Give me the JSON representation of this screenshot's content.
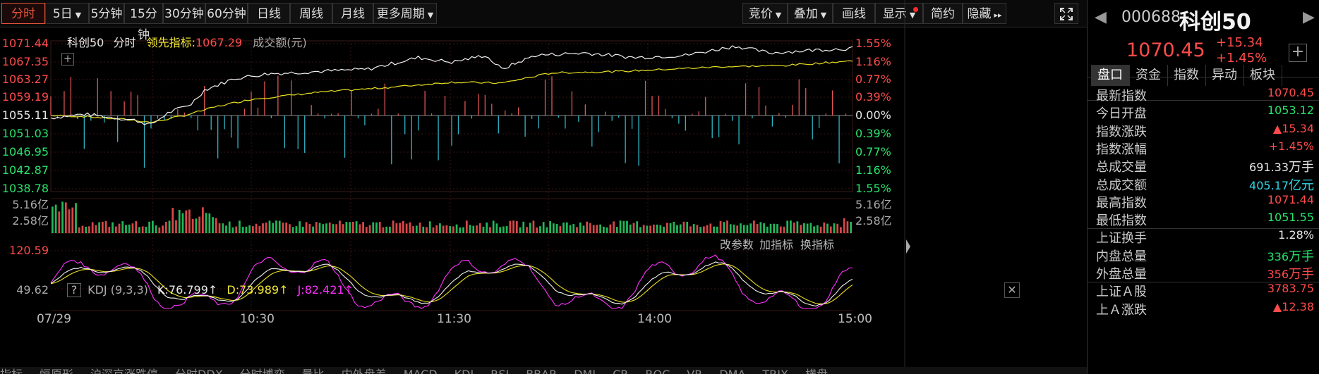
{
  "toolbar": {
    "left_buttons": [
      {
        "label": "分时",
        "active": true
      },
      {
        "label": "5日",
        "dropdown": true
      },
      {
        "label": "5分钟"
      },
      {
        "label": "15分钟"
      },
      {
        "label": "30分钟"
      },
      {
        "label": "60分钟"
      },
      {
        "label": "日线"
      },
      {
        "label": "周线"
      },
      {
        "label": "月线"
      },
      {
        "label": "更多周期",
        "dropdown": true
      }
    ],
    "right_buttons": [
      {
        "label": "竞价",
        "dropdown": true
      },
      {
        "label": "叠加",
        "dropdown": true
      },
      {
        "label": "画线"
      },
      {
        "label": "显示",
        "dropdown": true,
        "dot": true
      },
      {
        "label": "简约"
      },
      {
        "label": "隐藏",
        "arrows": "▸▸"
      }
    ]
  },
  "legend": {
    "name": "科创50",
    "mode": "分时",
    "lead_label": "领先指标:",
    "lead_value": "1067.29",
    "volume_label": "成交额(元)"
  },
  "price_axis": {
    "left": [
      "1071.44",
      "1067.35",
      "1063.27",
      "1059.19",
      "1055.11",
      "1051.03",
      "1046.95",
      "1042.87",
      "1038.78"
    ],
    "right": [
      "1.55%",
      "1.16%",
      "0.77%",
      "0.39%",
      "0.00%",
      "0.39%",
      "0.77%",
      "1.16%",
      "1.55%"
    ]
  },
  "volume_axis": {
    "top": "5.16亿",
    "mid": "2.58亿"
  },
  "kdj": {
    "label": "KDJ (9,3,3)",
    "k": "K:76.799↑",
    "d": "D:73.989↑",
    "j": "J:82.421↑",
    "axis_top": "120.59",
    "axis_mid": "49.62",
    "tools": [
      "改参数",
      "加指标",
      "换指标"
    ]
  },
  "time_axis": [
    "07/29",
    "10:30",
    "11:30",
    "14:00",
    "15:00"
  ],
  "chart_data": {
    "type": "line",
    "price_range": [
      1038.78,
      1071.44
    ],
    "prev_close": 1055.11,
    "x_range": [
      "09:30",
      "15:00"
    ],
    "series": [
      {
        "name": "科创50",
        "color": "#ffffff"
      },
      {
        "name": "领先指标",
        "color": "#f4ea32"
      }
    ]
  },
  "quote": {
    "code": "000688",
    "name": "科创50",
    "price": "1070.45",
    "change": "+15.34",
    "change_pct": "+1.45%"
  },
  "tabs": [
    "盘口",
    "资金",
    "指数",
    "异动",
    "板块"
  ],
  "stats": [
    {
      "label": "最新指数",
      "value": "1070.45",
      "color": "red"
    },
    {
      "label": "今日开盘",
      "value": "1053.12",
      "color": "green"
    },
    {
      "label": "指数涨跌",
      "value": "▲15.34",
      "color": "red"
    },
    {
      "label": "指数涨幅",
      "value": "+1.45%",
      "color": "red"
    },
    {
      "label": "总成交量",
      "value": "691.33",
      "unit": "万手",
      "color": "white"
    },
    {
      "label": "总成交额",
      "value": "405.17",
      "unit": "亿元",
      "color": "cyan"
    },
    {
      "label": "最高指数",
      "value": "1071.44",
      "color": "red"
    },
    {
      "label": "最低指数",
      "value": "1051.55",
      "color": "green"
    },
    {
      "label": "上证换手",
      "value": "1.28%",
      "color": "white"
    },
    {
      "label": "内盘总量",
      "value": "336",
      "unit": "万手",
      "color": "green"
    },
    {
      "label": "外盘总量",
      "value": "356",
      "unit": "万手",
      "color": "red"
    },
    {
      "label": "上证Ａ股",
      "value": "3783.75",
      "color": "red"
    },
    {
      "label": "上Ａ涨跌",
      "value": "▲12.38",
      "color": "red"
    }
  ],
  "bottom_tabs": [
    "指标",
    "恒原形",
    "沪深京涨跌停",
    "分时DDX",
    "分时博弈",
    "量比",
    "内外盘差",
    "MACD",
    "KDJ",
    "RSI",
    "BBAR",
    "DMI",
    "CR",
    "ROC",
    "VR",
    "DMA",
    "TRIX",
    "横盘"
  ]
}
